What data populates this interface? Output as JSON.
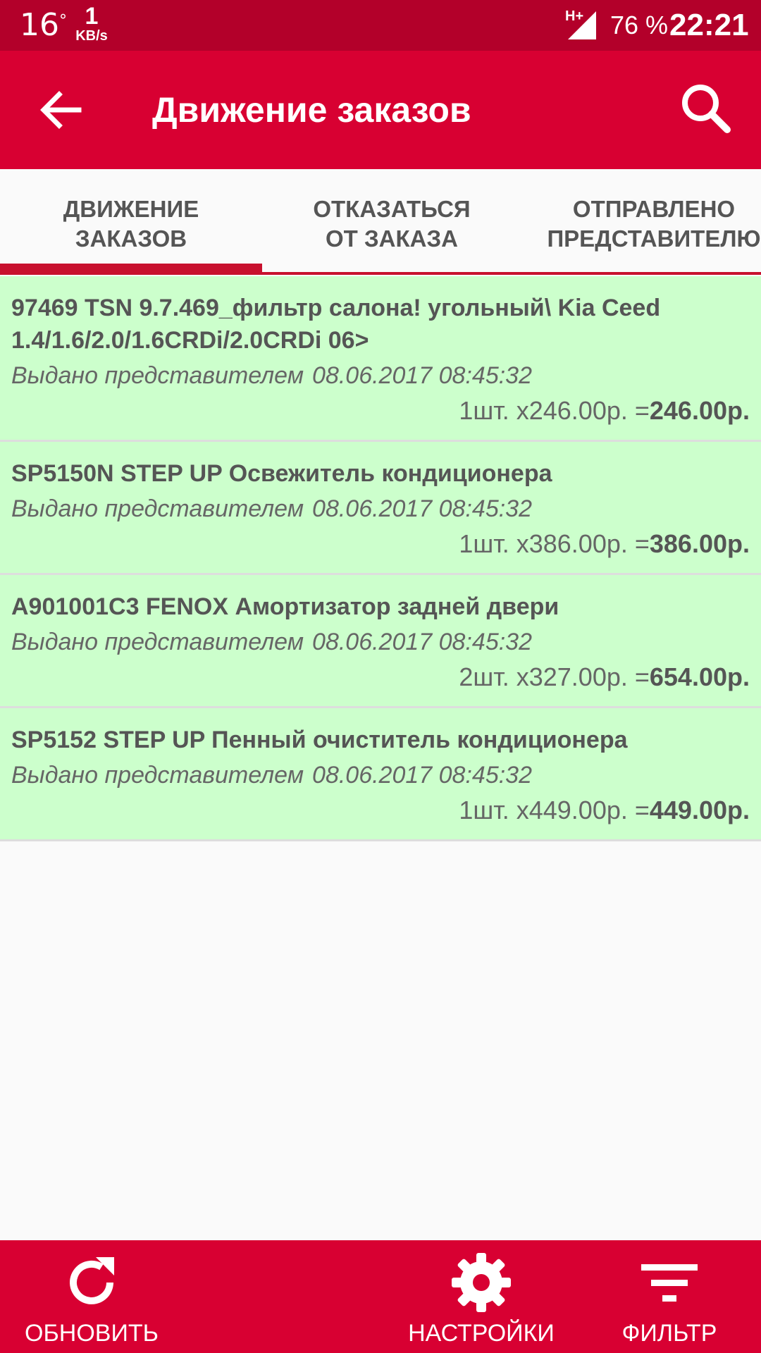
{
  "status_bar": {
    "temperature": "16",
    "degree": "°",
    "speed_value": "1",
    "speed_unit": "KB/s",
    "network": "H+",
    "battery": "76 %",
    "time": "22:21"
  },
  "app_bar": {
    "title": "Движение заказов",
    "back_icon": "arrow-left-icon",
    "search_icon": "search-icon"
  },
  "tabs": [
    {
      "label": "ДВИЖЕНИЕ\nЗАКАЗОВ",
      "selected": true
    },
    {
      "label": "ОТКАЗАТЬСЯ\nОТ ЗАКАЗА",
      "selected": false
    },
    {
      "label": "ОТПРАВЛЕНО\nПРЕДСТАВИТЕЛЮ",
      "selected": false
    }
  ],
  "orders": [
    {
      "title": "97469 TSN 9.7.469_фильтр салона! угольный\\ Kia Ceed 1.4/1.6/2.0/1.6CRDi/2.0CRDi 06>",
      "status": "Выдано представителем",
      "date": "08.06.2017 08:45:32",
      "calc": "1шт. x246.00р. =",
      "total": "246.00р."
    },
    {
      "title": "SP5150N STEP UP Освежитель кондиционера",
      "status": "Выдано представителем",
      "date": "08.06.2017 08:45:32",
      "calc": "1шт. x386.00р. =",
      "total": "386.00р."
    },
    {
      "title": "A901001C3 FENOX Амортизатор задней двери",
      "status": "Выдано представителем",
      "date": "08.06.2017 08:45:32",
      "calc": "2шт. x327.00р. =",
      "total": "654.00р."
    },
    {
      "title": "SP5152 STEP UP Пенный очиститель кондиционера",
      "status": "Выдано представителем",
      "date": "08.06.2017 08:45:32",
      "calc": "1шт. x449.00р. =",
      "total": "449.00р."
    }
  ],
  "bottom_bar": {
    "refresh_label": "ОБНОВИТЬ",
    "settings_label": "НАСТРОЙКИ",
    "filter_label": "ФИЛЬТР"
  },
  "colors": {
    "status_bar": "#b3002a",
    "primary": "#d80032",
    "item_background": "#ccffcc",
    "text": "#555555"
  }
}
